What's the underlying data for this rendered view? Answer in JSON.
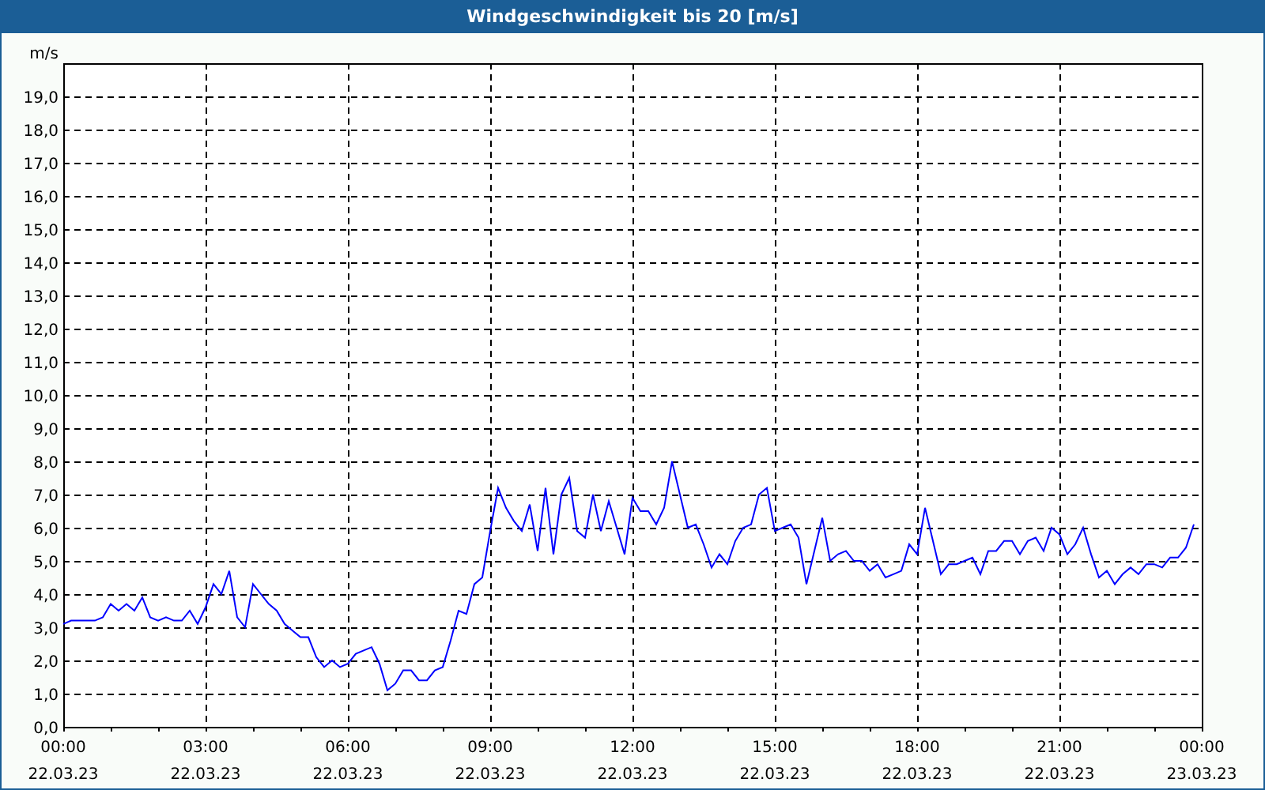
{
  "window": {
    "title": "Windgeschwindigkeit bis 20 [m/s]"
  },
  "chart": {
    "chart_data": {
      "type": "line",
      "grid": true,
      "ylabel": "m/s",
      "ylim": [
        0,
        20
      ],
      "yticks": [
        {
          "value": 0,
          "label": "0,0"
        },
        {
          "value": 1,
          "label": "1,0"
        },
        {
          "value": 2,
          "label": "2,0"
        },
        {
          "value": 3,
          "label": "3,0"
        },
        {
          "value": 4,
          "label": "4,0"
        },
        {
          "value": 5,
          "label": "5,0"
        },
        {
          "value": 6,
          "label": "6,0"
        },
        {
          "value": 7,
          "label": "7,0"
        },
        {
          "value": 8,
          "label": "8,0"
        },
        {
          "value": 9,
          "label": "9,0"
        },
        {
          "value": 10,
          "label": "10,0"
        },
        {
          "value": 11,
          "label": "11,0"
        },
        {
          "value": 12,
          "label": "12,0"
        },
        {
          "value": 13,
          "label": "13,0"
        },
        {
          "value": 14,
          "label": "14,0"
        },
        {
          "value": 15,
          "label": "15,0"
        },
        {
          "value": 16,
          "label": "16,0"
        },
        {
          "value": 17,
          "label": "17,0"
        },
        {
          "value": 18,
          "label": "18,0"
        },
        {
          "value": 19,
          "label": "19,0"
        }
      ],
      "categories": [
        "00:00 22.03.23",
        null,
        null,
        null,
        null,
        null,
        null,
        null,
        null,
        null,
        null,
        null,
        null,
        null,
        null,
        null,
        null,
        null,
        "03:00 22.03.23",
        null,
        null,
        null,
        null,
        null,
        null,
        null,
        null,
        null,
        null,
        null,
        null,
        null,
        null,
        null,
        null,
        null,
        "06:00 22.03.23",
        null,
        null,
        null,
        null,
        null,
        null,
        null,
        null,
        null,
        null,
        null,
        null,
        null,
        null,
        null,
        null,
        null,
        "09:00 22.03.23",
        null,
        null,
        null,
        null,
        null,
        null,
        null,
        null,
        null,
        null,
        null,
        null,
        null,
        null,
        null,
        null,
        null,
        "12:00 22.03.23",
        null,
        null,
        null,
        null,
        null,
        null,
        null,
        null,
        null,
        null,
        null,
        null,
        null,
        null,
        null,
        null,
        null,
        "15:00 22.03.23",
        null,
        null,
        null,
        null,
        null,
        null,
        null,
        null,
        null,
        null,
        null,
        null,
        null,
        null,
        null,
        null,
        null,
        "18:00 22.03.23",
        null,
        null,
        null,
        null,
        null,
        null,
        null,
        null,
        null,
        null,
        null,
        null,
        null,
        null,
        null,
        null,
        null,
        "21:00 22.03.23",
        null,
        null,
        null,
        null,
        null,
        null,
        null,
        null,
        null,
        null,
        null,
        null,
        null,
        null,
        null,
        null,
        null,
        "00:00 23.03.23"
      ],
      "series": [
        {
          "color": "#0000ff",
          "values": [
            3.1,
            3.2,
            3.2,
            3.2,
            3.2,
            3.3,
            3.7,
            3.5,
            3.7,
            3.5,
            3.9,
            3.3,
            3.2,
            3.3,
            3.2,
            3.2,
            3.5,
            3.1,
            3.6,
            4.3,
            4.0,
            4.7,
            3.3,
            3.0,
            4.3,
            4.0,
            3.7,
            3.5,
            3.1,
            2.9,
            2.7,
            2.7,
            2.1,
            1.8,
            2.0,
            1.8,
            1.9,
            2.2,
            2.3,
            2.4,
            1.9,
            1.1,
            1.3,
            1.7,
            1.7,
            1.4,
            1.4,
            1.7,
            1.8,
            2.6,
            3.5,
            3.4,
            4.3,
            4.5,
            5.9,
            7.2,
            6.6,
            6.2,
            5.9,
            6.7,
            5.3,
            7.2,
            5.2,
            7.0,
            7.5,
            5.9,
            5.7,
            7.0,
            5.9,
            6.8,
            6.0,
            5.2,
            6.9,
            6.5,
            6.5,
            6.1,
            6.6,
            8.0,
            7.0,
            6.0,
            6.1,
            5.5,
            4.8,
            5.2,
            4.9,
            5.6,
            6.0,
            6.1,
            7.0,
            7.2,
            5.9,
            6.0,
            6.1,
            5.7,
            4.3,
            5.3,
            6.3,
            5.0,
            5.2,
            5.3,
            5.0,
            5.0,
            4.7,
            4.9,
            4.5,
            4.6,
            4.7,
            5.5,
            5.2,
            6.6,
            5.6,
            4.6,
            4.9,
            4.9,
            5.0,
            5.1,
            4.6,
            5.3,
            5.3,
            5.6,
            5.6,
            5.2,
            5.6,
            5.7,
            5.3,
            6.0,
            5.8,
            5.2,
            5.5,
            6.0,
            5.2,
            4.5,
            4.7,
            4.3,
            4.6,
            4.8,
            4.6,
            4.9,
            4.9,
            4.8,
            5.1,
            5.1,
            5.4,
            6.1,
            null
          ]
        }
      ]
    }
  }
}
